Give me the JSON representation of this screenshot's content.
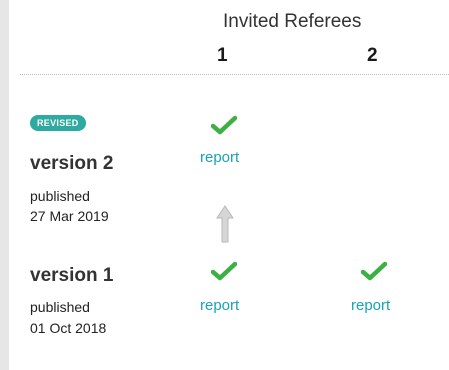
{
  "header": {
    "title": "Invited Referees",
    "columns": [
      "1",
      "2"
    ]
  },
  "versions": [
    {
      "badge": "REVISED",
      "title": "version 2",
      "published_label": "published",
      "date": "27 Mar 2019",
      "referees": [
        {
          "status": "approved",
          "link": "report"
        },
        {
          "status": "none",
          "link": ""
        }
      ]
    },
    {
      "badge": "",
      "title": "version 1",
      "published_label": "published",
      "date": "01 Oct 2018",
      "referees": [
        {
          "status": "approved",
          "link": "report"
        },
        {
          "status": "approved",
          "link": "report"
        }
      ]
    }
  ],
  "colors": {
    "check": "#3cb043",
    "link": "#19a3b8",
    "badge": "#2eaaa0",
    "arrow": "#c4c4c4"
  },
  "icons": [
    "check-icon",
    "up-arrow-icon"
  ]
}
